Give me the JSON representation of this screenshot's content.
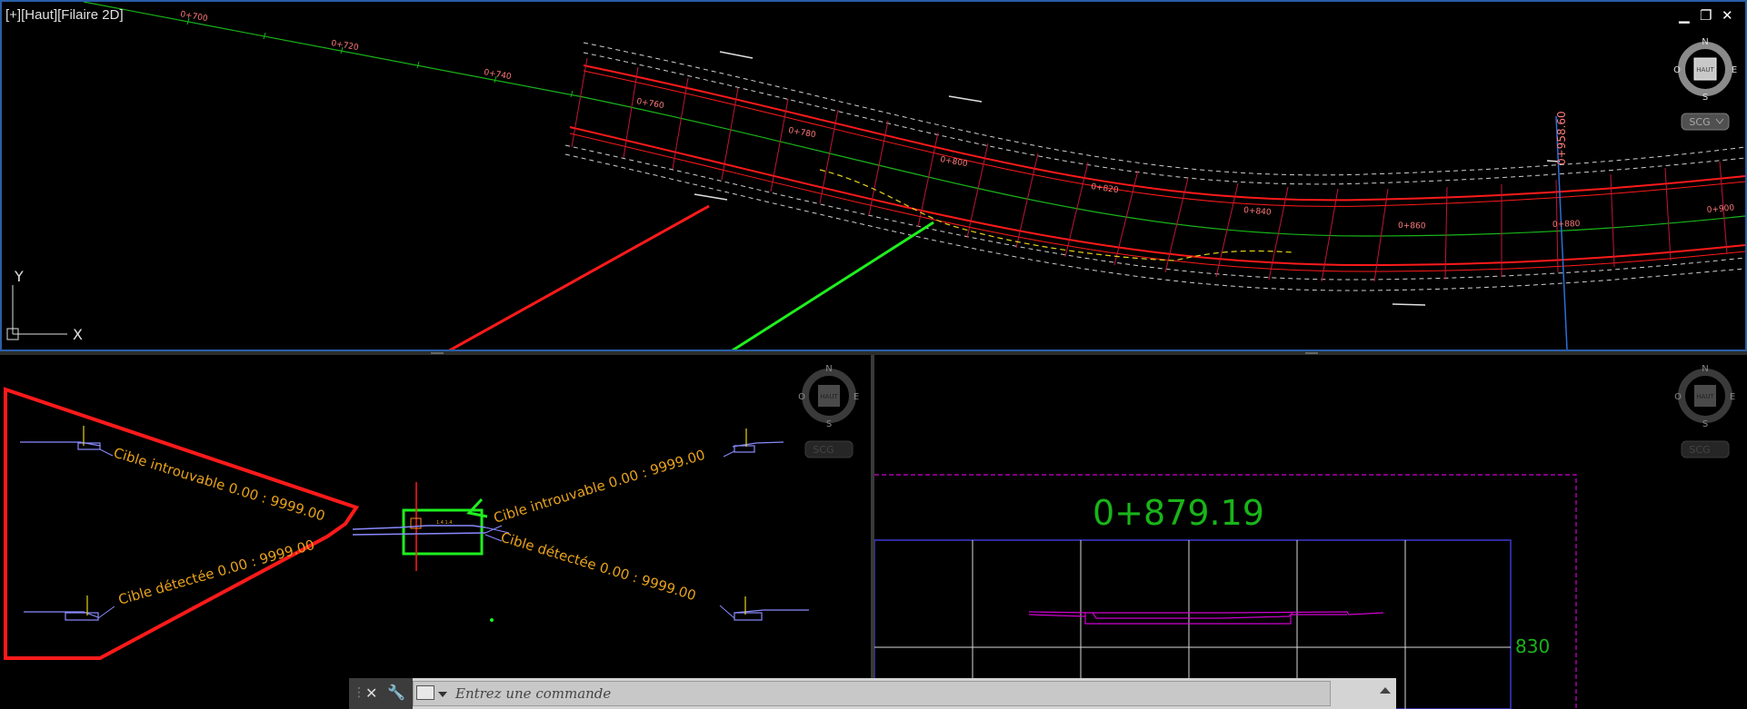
{
  "viewport_top": {
    "label": "[+][Haut][Filaire 2D]",
    "minimize_label": "▁",
    "restore_label": "❐",
    "close_label": "✕",
    "stations": [
      "0+700",
      "0+720",
      "0+740",
      "0+760",
      "0+780",
      "0+800",
      "0+820",
      "0+840",
      "0+860",
      "0+880",
      "0+900"
    ],
    "station_marker": "0+958.60",
    "viewcube": {
      "north": "N",
      "south": "S",
      "east": "E",
      "west": "O",
      "face": "HAUT"
    },
    "ucs_badge": "SCG",
    "axis_y": "Y",
    "axis_x": "X"
  },
  "viewport_left": {
    "viewcube": {
      "north": "N",
      "south": "S",
      "east": "E",
      "west": "O",
      "face": "HAUT"
    },
    "ucs_badge": "SCG",
    "annotations": {
      "target_not_found_left": "Cible introuvable   0.00 : 9999.00",
      "target_detected_left": "Cible détectée   0.00 : 9999.00",
      "target_not_found_right": "Cible introuvable   0.00 : 9999.00",
      "target_detected_right": "Cible détectée   0.00 : 9999.00"
    }
  },
  "viewport_right": {
    "viewcube": {
      "north": "N",
      "south": "S",
      "east": "E",
      "west": "O",
      "face": "HAUT"
    },
    "ucs_badge": "SCG",
    "section_station": "0+879.19",
    "elevation_label": "830"
  },
  "command_line": {
    "placeholder": "Entrez une commande",
    "close_glyph": "✕",
    "customize_glyph": "🔧"
  },
  "colors": {
    "accent_blue": "#2a5fa8",
    "red": "#ff1a1a",
    "green": "#1ef01e",
    "orange_text": "#e8a21c",
    "magenta": "#d000d0",
    "centerline_green": "#19b419"
  }
}
